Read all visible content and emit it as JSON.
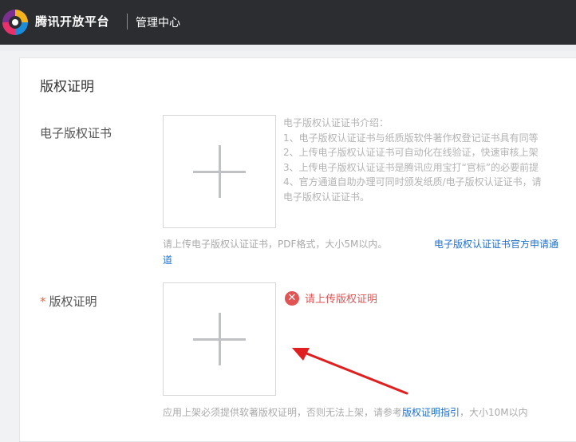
{
  "header": {
    "brand": "腾讯开放平台",
    "section": "管理中心"
  },
  "card": {
    "title": "版权证明"
  },
  "ecert": {
    "label": "电子版权证书",
    "intro_lines": [
      "电子版权认证证书介绍：",
      "1、电子版权认证证书与纸质版软件著作权登记证书具有同等",
      "2、上传电子版权认证证书可自动化在线验证，快速审核上架",
      "3、上传电子版权认证证书是腾讯应用宝打“官标”的必要前提",
      "4、官方通道自助办理可同时颁发纸质/电子版权认证证书，请",
      "电子版权认证证书。"
    ],
    "hint": "请上传电子版权认证证书，PDF格式，大小5M以内。",
    "link_text_1": "电子版权认证证书官方申请通",
    "link_text_2": "道"
  },
  "copyright": {
    "required_mark": "*",
    "label": "版权证明",
    "error": "请上传版权证明",
    "hint_prefix": "应用上架必须提供软著版权证明，否则无法上架，请参考",
    "hint_link": "版权证明指引",
    "hint_suffix": "，大小10M以内"
  },
  "colors": {
    "topbar": "#2b2d31",
    "link": "#1e6fd0",
    "error": "#e25353",
    "annotation_arrow": "#e02020"
  },
  "icons": {
    "logo": "tencent-logo-icon",
    "upload": "plus-icon",
    "error": "close-circle-icon",
    "annotation": "red-arrow-icon"
  }
}
